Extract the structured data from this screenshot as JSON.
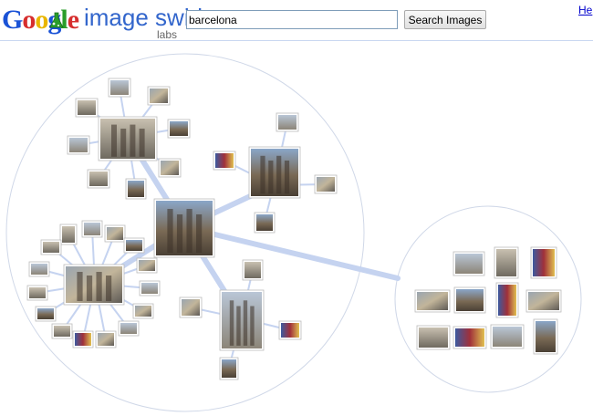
{
  "logo": {
    "letters": [
      {
        "char": "G",
        "color": "#1a52d6"
      },
      {
        "char": "o",
        "color": "#d62e2e"
      },
      {
        "char": "o",
        "color": "#e9b600"
      },
      {
        "char": "g",
        "color": "#1a52d6"
      },
      {
        "char": "l",
        "color": "#2a9d2a"
      },
      {
        "char": "e",
        "color": "#d62e2e"
      }
    ],
    "product": "image swirl",
    "badge": "labs",
    "flask_icon": "flask-icon"
  },
  "search": {
    "query": "barcelona",
    "button_label": "Search Images"
  },
  "header": {
    "help_link": "He"
  },
  "colors": {
    "link": "#0000cc",
    "edge": "#c5d3f0",
    "circle": "#d0d8e8",
    "thumb_border": "#bbbbbb"
  },
  "swirl": {
    "clusters": [
      {
        "name": "main-cluster",
        "hub_icon": "sagrada-familia-photo",
        "groups": [
          {
            "name": "sagrada-familia-facade",
            "count": 9
          },
          {
            "name": "sagrada-familia-towers",
            "count": 4
          },
          {
            "name": "park-guell-mosaic",
            "count": 22
          },
          {
            "name": "casa-batllo",
            "count": 4
          }
        ]
      },
      {
        "name": "side-cluster",
        "images": [
          "city-view",
          "metro-map",
          "fc-barcelona-team",
          "cityscape",
          "cathedral",
          "sagrada-detail",
          "mosaic",
          "street-crowd",
          "people",
          "crowd",
          "portrait"
        ]
      }
    ]
  }
}
